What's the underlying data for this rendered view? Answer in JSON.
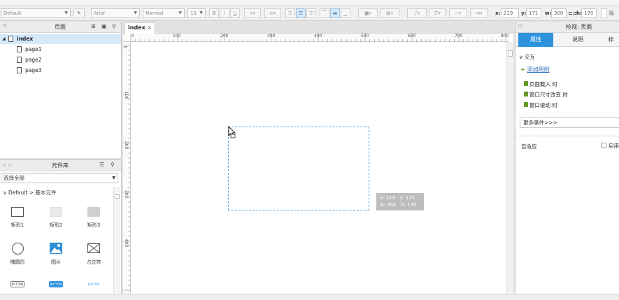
{
  "toolbar": {
    "style_select": "Default",
    "font_select": "Arial",
    "weight_select": "Normal",
    "size_select": "13",
    "bold": "B",
    "italic": "I",
    "underline": "U",
    "x_label": "x:",
    "x_value": "219",
    "y_label": "y:",
    "y_value": "171",
    "w_label": "w:",
    "w_value": "300",
    "h_label": "h:",
    "h_value": "170",
    "hidden_label": "隐"
  },
  "pages_panel": {
    "title": "页面",
    "pages": [
      {
        "label": "index",
        "selected": true
      },
      {
        "label": "page1",
        "selected": false
      },
      {
        "label": "page2",
        "selected": false
      },
      {
        "label": "page3",
        "selected": false
      }
    ]
  },
  "library": {
    "title": "元件库",
    "select_value": "选择全部",
    "section": "Default > 基本元件",
    "widgets": [
      {
        "label": "矩形1",
        "icon": "rectangle-icon"
      },
      {
        "label": "矩形2",
        "icon": "rectangle-filled-icon"
      },
      {
        "label": "矩形3",
        "icon": "rectangle-dark-icon"
      },
      {
        "label": "椭圆形",
        "icon": "ellipse-icon"
      },
      {
        "label": "图片",
        "icon": "image-icon"
      },
      {
        "label": "占位符",
        "icon": "placeholder-icon"
      },
      {
        "label": "BUTTON",
        "icon": "button-outline-icon"
      },
      {
        "label": "BUTTON",
        "icon": "button-primary-icon"
      },
      {
        "label": "BUTTON",
        "icon": "button-link-icon"
      }
    ]
  },
  "canvas": {
    "tab_label": "index",
    "ruler_h": [
      "0",
      "100",
      "200",
      "300",
      "400",
      "500",
      "600",
      "700",
      "800"
    ],
    "ruler_v": [
      "0",
      "100",
      "200",
      "300",
      "400"
    ],
    "tooltip": {
      "x": "x: 219",
      "y": "y: 171",
      "w": "w: 300",
      "h": "h: 170"
    }
  },
  "inspector": {
    "title": "检视: 页面",
    "tabs": [
      "属性",
      "说明",
      "样"
    ],
    "section_interaction": "交互",
    "add_case": "添加用例",
    "events": [
      "页面载入 时",
      "窗口尺寸改变 时",
      "窗口滚动 时"
    ],
    "more_events": "更多事件>>>",
    "adaptive_label": "自适应",
    "enable_label": "启用"
  },
  "colors": {
    "accent": "#2e93de",
    "selection": "#5b9fd3",
    "event_icon": "#6a9a2a"
  }
}
